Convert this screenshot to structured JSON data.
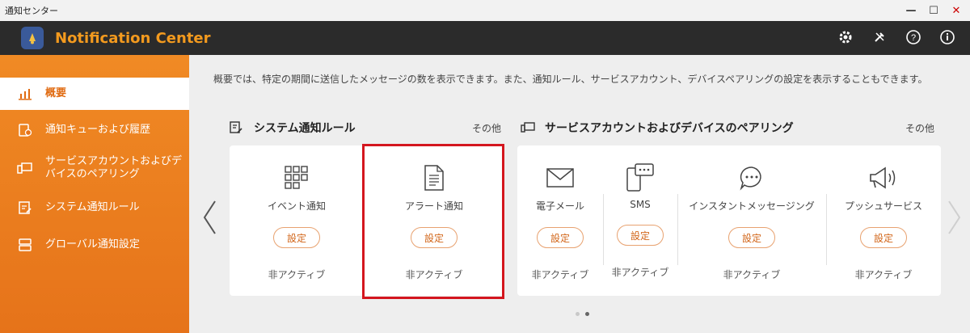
{
  "window": {
    "title": "通知センター",
    "minimize_label": "—",
    "maximize_label": "☐",
    "close_label": "✕"
  },
  "header": {
    "title": "Notification Center"
  },
  "sidebar": {
    "items": [
      {
        "label": "概要",
        "icon": "chart-icon"
      },
      {
        "label": "通知キューおよび履歴",
        "icon": "queue-history-icon"
      },
      {
        "label": "サービスアカウントおよびデバイスのペアリング",
        "icon": "device-pairing-icon"
      },
      {
        "label": "システム通知ルール",
        "icon": "rules-icon"
      },
      {
        "label": "グローバル通知設定",
        "icon": "global-settings-icon"
      }
    ]
  },
  "main": {
    "description": "概要では、特定の期間に送信したメッセージの数を表示できます。また、通知ルール、サービスアカウント、デバイスペアリングの設定を表示することもできます。",
    "rules_section": {
      "title": "システム通知ルール",
      "more": "その他",
      "cards": [
        {
          "title": "イベント通知",
          "button": "設定",
          "status": "非アクティブ"
        },
        {
          "title": "アラート通知",
          "button": "設定",
          "status": "非アクティブ"
        }
      ]
    },
    "pairing_section": {
      "title": "サービスアカウントおよびデバイスのペアリング",
      "more": "その他",
      "cards": [
        {
          "title": "電子メール",
          "button": "設定",
          "status": "非アクティブ"
        },
        {
          "title": "SMS",
          "button": "設定",
          "status": "非アクティブ"
        },
        {
          "title": "インスタントメッセージング",
          "button": "設定",
          "status": "非アクティブ"
        },
        {
          "title": "プッシュサービス",
          "button": "設定",
          "status": "非アクティブ"
        }
      ]
    },
    "pagination": {
      "pages": 2,
      "current": 2
    }
  },
  "colors": {
    "accent": "#f08a24",
    "header_bg": "#2b2b2b",
    "title_orange": "#f39a1e",
    "highlight": "#d4161e"
  }
}
